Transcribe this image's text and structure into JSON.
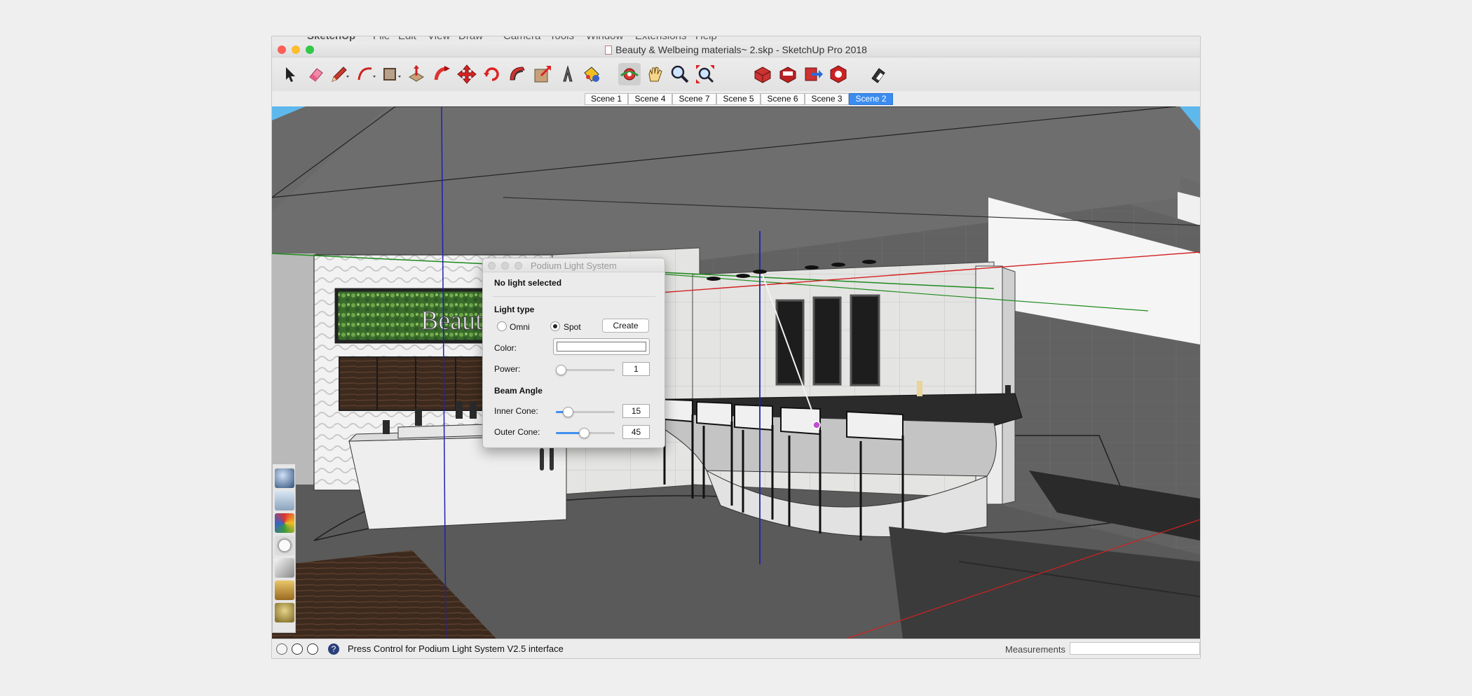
{
  "menubar": {
    "items": [
      "SketchUp",
      "File",
      "Edit",
      "View",
      "Draw",
      "Camera",
      "Tools",
      "Window",
      "Extensions",
      "Help"
    ]
  },
  "window": {
    "title": "Beauty & Welbeing materials~ 2.skp - SketchUp Pro 2018",
    "traffic_colors": [
      "#fc5f57",
      "#fdbc2e",
      "#33c748"
    ]
  },
  "toolbar": {
    "tools": [
      "select-tool",
      "eraser-tool",
      "pencil-line-tool",
      "arc-tool",
      "rectangle-tool",
      "push-pull-tool",
      "follow-me-tool",
      "move-tool",
      "rotate-tool",
      "offset-tool",
      "scale-tool",
      "tape-measure-tool",
      "paint-bucket-tool",
      "orbit-tool",
      "pan-tool",
      "zoom-tool",
      "zoom-extents-tool",
      "component-tool",
      "3d-warehouse-tool",
      "share-model-tool",
      "extension-warehouse-tool",
      "layout-tool"
    ],
    "pressed": "orbit-tool"
  },
  "scenes": {
    "tabs": [
      "Scene 1",
      "Scene 4",
      "Scene 7",
      "Scene 5",
      "Scene 6",
      "Scene 3",
      "Scene 2"
    ],
    "active": "Scene 2"
  },
  "dialog": {
    "title": "Podium Light System",
    "status": "No light selected",
    "light_type_label": "Light type",
    "omni_label": "Omni",
    "spot_label": "Spot",
    "selected_type": "Spot",
    "create_label": "Create",
    "color_label": "Color:",
    "color_value": "#ffffff",
    "power_label": "Power:",
    "power_value": "1",
    "beam_angle_label": "Beam Angle",
    "inner_cone_label": "Inner Cone:",
    "inner_cone_value": "15",
    "outer_cone_label": "Outer Cone:",
    "outer_cone_value": "45"
  },
  "scene": {
    "sign_text": "Beaut",
    "accent_red": "#d42020",
    "accent_green": "#1d8a1d",
    "accent_blue": "#2020b0",
    "sky": "#5eb8ec"
  },
  "statusbar": {
    "text": "Press Control for Podium Light System V2.5 interface",
    "measurements_label": "Measurements",
    "measurements_value": ""
  }
}
